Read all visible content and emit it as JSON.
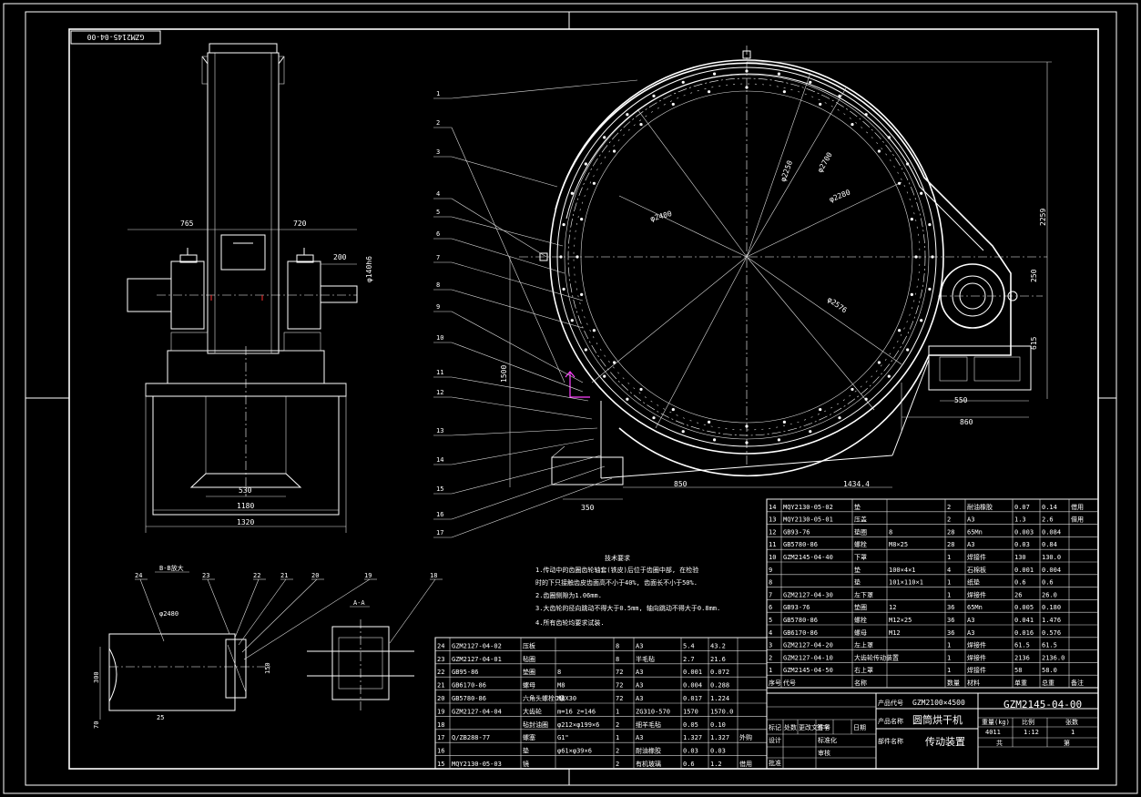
{
  "drawing_number": "GZM2145-04-00",
  "drawing_number_rotated": "GZM2145-04-00",
  "tech_req": {
    "title": "技术要求",
    "items": [
      "1.传动中的齿圈齿轮轴套(铁皮)后位于齿圈中部, 在检验",
      "  时的下只接触齿皮齿面高不小于40%, 齿面长不小于50%.",
      "2.齿圈侧隙为1.06mm.",
      "3.大齿轮的径向跳动不得大于0.5mm, 轴向跳动不得大于0.8mm.",
      "4.所有齿轮均要求试装."
    ]
  },
  "front_view": {
    "dims": [
      "765",
      "720",
      "200",
      "φ140h6",
      "530",
      "1180",
      "1320"
    ]
  },
  "main_view": {
    "dims": [
      "φ2250",
      "φ2700",
      "φ2400",
      "φ2280",
      "φ2576",
      "2259",
      "250",
      "615",
      "550",
      "860",
      "1500",
      "350",
      "850",
      "1434.4"
    ],
    "callouts": [
      "1",
      "2",
      "3",
      "4",
      "5",
      "6",
      "7",
      "8",
      "9",
      "10",
      "11",
      "12",
      "13",
      "14",
      "15",
      "16",
      "17"
    ]
  },
  "section_b": {
    "title": "B-B放大",
    "callouts": [
      "24",
      "23",
      "22",
      "21",
      "20",
      "19"
    ],
    "dims": [
      "φ2480",
      "300",
      "150",
      "25",
      "70"
    ]
  },
  "section_a": {
    "title": "A-A",
    "callout": "18"
  },
  "bom_right": [
    {
      "no": "14",
      "code": "MQY2130-05-02",
      "name": "垫",
      "spec": "",
      "qty": "2",
      "mat": "耐油橡胶",
      "w1": "0.07",
      "w2": "0.14",
      "note": "借用"
    },
    {
      "no": "13",
      "code": "MQY2130-05-01",
      "name": "压盖",
      "spec": "",
      "qty": "2",
      "mat": "A3",
      "w1": "1.3",
      "w2": "2.6",
      "note": "借用"
    },
    {
      "no": "12",
      "code": "GB93-76",
      "name": "垫圈",
      "spec": "8",
      "qty": "28",
      "mat": "65Mn",
      "w1": "0.003",
      "w2": "0.084",
      "note": ""
    },
    {
      "no": "11",
      "code": "GB5780-86",
      "name": "螺栓",
      "spec": "M8×25",
      "qty": "28",
      "mat": "A3",
      "w1": "0.03",
      "w2": "0.84",
      "note": ""
    },
    {
      "no": "10",
      "code": "GZM2145-04-40",
      "name": "下罩",
      "spec": "",
      "qty": "1",
      "mat": "焊接件",
      "w1": "130",
      "w2": "130.0",
      "note": ""
    },
    {
      "no": "9",
      "code": "",
      "name": "垫",
      "spec": "100×4×1",
      "qty": "4",
      "mat": "石棉板",
      "w1": "0.001",
      "w2": "0.004",
      "note": ""
    },
    {
      "no": "8",
      "code": "",
      "name": "垫",
      "spec": "101×110×1",
      "qty": "1",
      "mat": "纸垫",
      "w1": "0.6",
      "w2": "0.6",
      "note": ""
    },
    {
      "no": "7",
      "code": "GZM2127-04-30",
      "name": "左下罩",
      "spec": "",
      "qty": "1",
      "mat": "焊接件",
      "w1": "26",
      "w2": "26.0",
      "note": ""
    },
    {
      "no": "6",
      "code": "GB93-76",
      "name": "垫圈",
      "spec": "12",
      "qty": "36",
      "mat": "65Mn",
      "w1": "0.005",
      "w2": "0.180",
      "note": ""
    },
    {
      "no": "5",
      "code": "GB5780-86",
      "name": "螺栓",
      "spec": "M12×25",
      "qty": "36",
      "mat": "A3",
      "w1": "0.041",
      "w2": "1.476",
      "note": ""
    },
    {
      "no": "4",
      "code": "GB6170-86",
      "name": "螺母",
      "spec": "M12",
      "qty": "36",
      "mat": "A3",
      "w1": "0.016",
      "w2": "0.576",
      "note": ""
    },
    {
      "no": "3",
      "code": "GZM2127-04-20",
      "name": "左上罩",
      "spec": "",
      "qty": "1",
      "mat": "焊接件",
      "w1": "61.5",
      "w2": "61.5",
      "note": ""
    },
    {
      "no": "2",
      "code": "GZM2127-04-10",
      "name": "大齿轮传动装置",
      "spec": "",
      "qty": "1",
      "mat": "焊接件",
      "w1": "2136",
      "w2": "2136.0",
      "note": ""
    },
    {
      "no": "1",
      "code": "GZM2145-04-50",
      "name": "右上罩",
      "spec": "",
      "qty": "1",
      "mat": "焊接件",
      "w1": "58",
      "w2": "58.0",
      "note": ""
    }
  ],
  "bom_right_header": [
    "序号",
    "代号",
    "名称",
    "数量",
    "材料",
    "单重",
    "总重",
    "备注"
  ],
  "bom_left": [
    {
      "no": "24",
      "code": "GZM2127-04-02",
      "name": "压板",
      "spec": "",
      "qty": "8",
      "mat": "A3",
      "w1": "5.4",
      "w2": "43.2",
      "note": ""
    },
    {
      "no": "23",
      "code": "GZM2127-04-01",
      "name": "毡圈",
      "spec": "",
      "qty": "8",
      "mat": "半毛毡",
      "w1": "2.7",
      "w2": "21.6",
      "note": ""
    },
    {
      "no": "22",
      "code": "GB95-86",
      "name": "垫圈",
      "spec": "8",
      "qty": "72",
      "mat": "A3",
      "w1": "0.001",
      "w2": "0.072",
      "note": ""
    },
    {
      "no": "21",
      "code": "GB6170-86",
      "name": "螺母",
      "spec": "M8",
      "qty": "72",
      "mat": "A3",
      "w1": "0.004",
      "w2": "0.288",
      "note": ""
    },
    {
      "no": "20",
      "code": "GB5780-86",
      "name": "六角头螺栓C级",
      "spec": "M8X30",
      "qty": "72",
      "mat": "A3",
      "w1": "0.017",
      "w2": "1.224",
      "note": ""
    },
    {
      "no": "19",
      "code": "GZM2127-04-04",
      "name": "大齿轮",
      "spec": "m=16 z=146",
      "qty": "1",
      "mat": "ZG310-570",
      "w1": "1570",
      "w2": "1570.0",
      "note": ""
    },
    {
      "no": "18",
      "code": "",
      "name": "毡封油圈",
      "spec": "φ212×φ199×6",
      "qty": "2",
      "mat": "细羊毛毡",
      "w1": "0.05",
      "w2": "0.10",
      "note": ""
    },
    {
      "no": "17",
      "code": "Q/ZB288-77",
      "name": "螺塞",
      "spec": "G1\"",
      "qty": "1",
      "mat": "A3",
      "w1": "1.327",
      "w2": "1.327",
      "note": "外购"
    },
    {
      "no": "16",
      "code": "",
      "name": "垫",
      "spec": "φ61×φ39×6",
      "qty": "2",
      "mat": "耐油橡胶",
      "w1": "0.03",
      "w2": "0.03",
      "note": ""
    },
    {
      "no": "15",
      "code": "MQY2130-05-03",
      "name": "镜",
      "spec": "",
      "qty": "2",
      "mat": "有机玻璃",
      "w1": "0.6",
      "w2": "1.2",
      "note": "借用"
    }
  ],
  "title_block": {
    "product_code": "GZM2100×4500",
    "product_name": "圆筒烘干机",
    "part_name": "传动装置",
    "drawing_no": "GZM2145-04-00",
    "weight": "4011",
    "scale": "1:12",
    "sheets": "1",
    "label_weight": "重量(kg)",
    "label_scale": "比例",
    "label_sheet": "张数",
    "row_labels": [
      "标记",
      "处数",
      "更改文件号",
      "签字",
      "日期"
    ],
    "label_design": "设计",
    "label_std": "标准化",
    "label_check": "审核",
    "label_proc": "工艺",
    "label_approve": "批准",
    "label_total": "共",
    "label_page": "第"
  }
}
